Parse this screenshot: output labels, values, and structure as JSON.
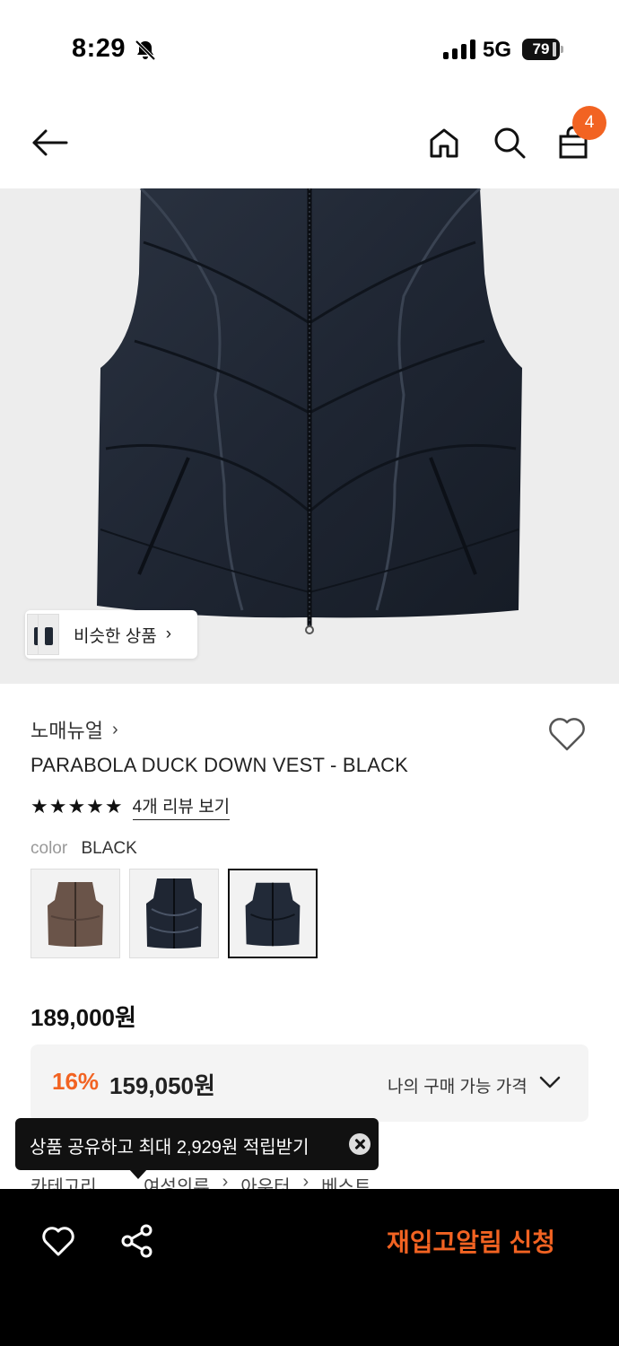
{
  "status_bar": {
    "time": "8:29",
    "network": "5G",
    "battery": "79"
  },
  "nav": {
    "cart_count": "4",
    "icons": [
      "back-arrow-icon",
      "home-icon",
      "search-icon",
      "shopping-bag-icon"
    ]
  },
  "hero": {
    "similar_label": "비슷한 상품",
    "similar_arrow": "›"
  },
  "product": {
    "brand": "노매뉴얼",
    "brand_arrow": "›",
    "name": "PARABOLA DUCK DOWN VEST - BLACK",
    "stars": "★★★★★",
    "rating": 5,
    "review_link": "4개 리뷰 보기",
    "color_label": "color",
    "color_value": "BLACK",
    "swatches": [
      {
        "color": "#6a5449",
        "label": "brown"
      },
      {
        "color": "#1f2633",
        "label": "glossy black"
      },
      {
        "color": "#222a38",
        "label": "black"
      }
    ],
    "selected_swatch": 2
  },
  "pricing": {
    "original": "189,000원",
    "discount": "16%",
    "sale": "159,050원",
    "my_price_label": "나의 구매 가능 가격"
  },
  "tooltip": {
    "text": "상품 공유하고 최대 2,929원 적립받기"
  },
  "breadcrumb": {
    "label": "카테고리",
    "items": [
      "여성의류",
      "아우터",
      "베스트"
    ],
    "sep": "›"
  },
  "bottom_bar": {
    "restock_label": "재입고알림 신청"
  },
  "colors": {
    "accent": "#f26322",
    "bottom_bar": "#000000",
    "hero_bg": "#ededed"
  }
}
